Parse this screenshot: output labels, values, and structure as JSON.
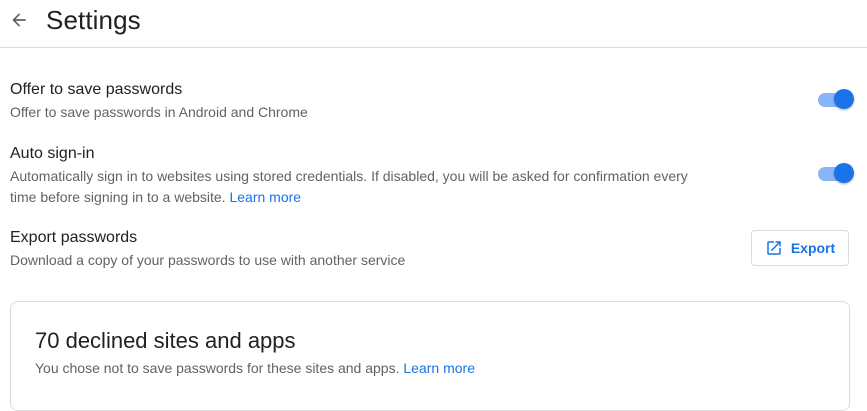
{
  "header": {
    "title": "Settings",
    "back_icon": "arrow-back-icon"
  },
  "settings": {
    "offer_to_save": {
      "title": "Offer to save passwords",
      "description": "Offer to save passwords in Android and Chrome",
      "enabled": true
    },
    "auto_sign_in": {
      "title": "Auto sign-in",
      "description": "Automatically sign in to websites using stored credentials. If disabled, you will be asked for confirmation every time before signing in to a website.",
      "link": "Learn more",
      "enabled": true
    },
    "export": {
      "title": "Export passwords",
      "description": "Download a copy of your passwords to use with another service",
      "button_label": "Export",
      "button_icon": "open-in-new-icon"
    }
  },
  "declined": {
    "title": "70 declined sites and apps",
    "description": "You chose not to save passwords for these sites and apps.",
    "link": "Learn more"
  },
  "colors": {
    "accent": "#1a73e8",
    "toggle_track": "#8ab4f8",
    "secondary_text": "#5f6368",
    "divider": "#dadce0"
  }
}
